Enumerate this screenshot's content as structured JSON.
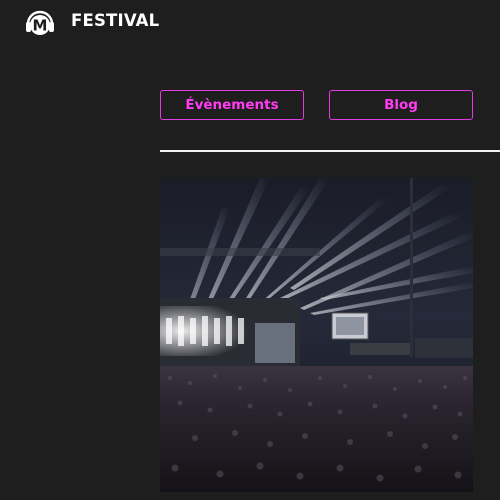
{
  "header": {
    "logo_letter": "M",
    "brand": "FESTIVAL",
    "logo_icon": "headphones-m-logo-icon"
  },
  "nav": {
    "events_label": "Évènements",
    "blog_label": "Blog"
  },
  "colors": {
    "background": "#1e1e1f",
    "accent": "#ff3cf0",
    "text": "#ffffff",
    "divider": "#f2f2f2"
  },
  "hero": {
    "subject": "concert-crowd-photo"
  }
}
